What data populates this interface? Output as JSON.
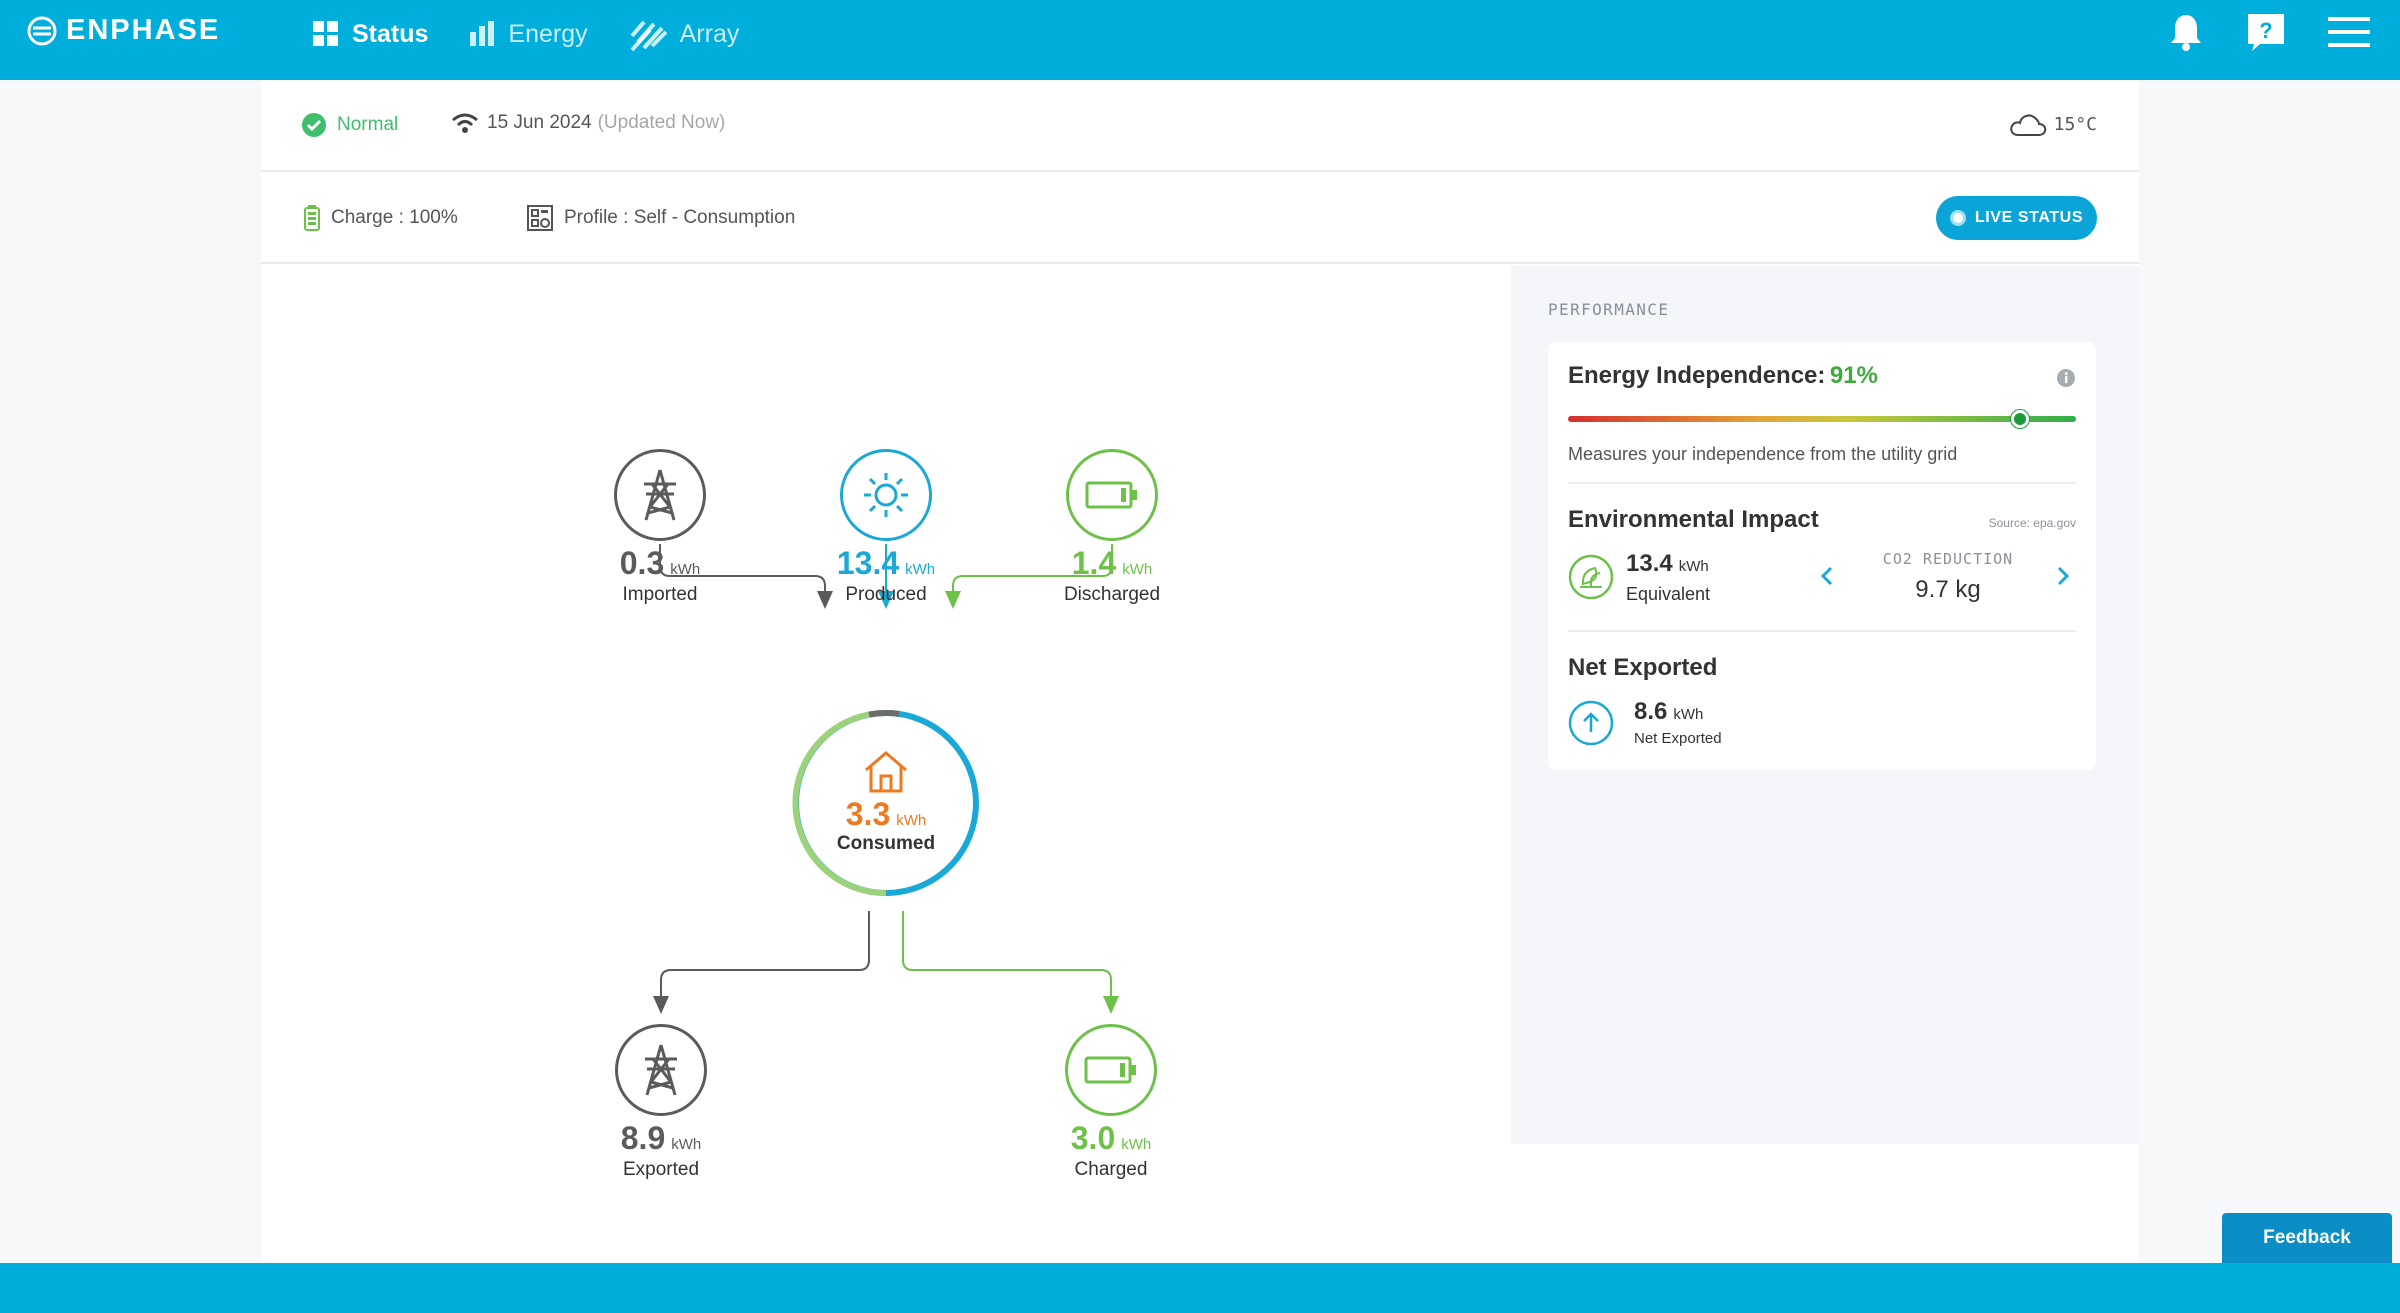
{
  "app": {
    "logo_text": "ENPHASE"
  },
  "nav": {
    "items": [
      {
        "label": "Status",
        "active": true,
        "icon": "grid-icon"
      },
      {
        "label": "Energy",
        "active": false,
        "icon": "bar-chart-icon"
      },
      {
        "label": "Array",
        "active": false,
        "icon": "solar-array-icon"
      }
    ]
  },
  "top_icons": [
    "bell-icon",
    "help-icon",
    "menu-icon"
  ],
  "status": {
    "state": "Normal",
    "date": "15 Jun 2024",
    "updated": "(Updated Now)",
    "weather": "15°C"
  },
  "info": {
    "charge": "Charge : 100%",
    "profile": "Profile : Self - Consumption",
    "live_status": "LIVE STATUS"
  },
  "flow": {
    "imported": {
      "value": "0.3",
      "unit": "kWh",
      "label": "Imported"
    },
    "produced": {
      "value": "13.4",
      "unit": "kWh",
      "label": "Produced"
    },
    "discharged": {
      "value": "1.4",
      "unit": "kWh",
      "label": "Discharged"
    },
    "consumed": {
      "value": "3.3",
      "unit": "kWh",
      "label": "Consumed"
    },
    "exported": {
      "value": "8.9",
      "unit": "kWh",
      "label": "Exported"
    },
    "charged": {
      "value": "3.0",
      "unit": "kWh",
      "label": "Charged"
    }
  },
  "performance": {
    "title": "PERFORMANCE",
    "energy_independence": {
      "label": "Energy Independence:",
      "value": "91%",
      "level": 0.89,
      "description": "Measures your independence from the utility grid"
    },
    "environmental": {
      "title": "Environmental Impact",
      "source": "Source: epa.gov",
      "value": "13.4",
      "unit": "kWh",
      "sub": "Equivalent",
      "co2_label": "CO2 REDUCTION",
      "co2_value": "9.7 kg"
    },
    "net_exported": {
      "title": "Net Exported",
      "value": "8.6",
      "unit": "kWh",
      "sub": "Net Exported"
    }
  },
  "feedback": "Feedback",
  "colors": {
    "brand": "#00aedb",
    "produced": "#1aa9d6",
    "battery": "#6dc048",
    "grid": "#5b5b5b",
    "consumed": "#ec7a21",
    "normal": "#3fbf6e"
  }
}
